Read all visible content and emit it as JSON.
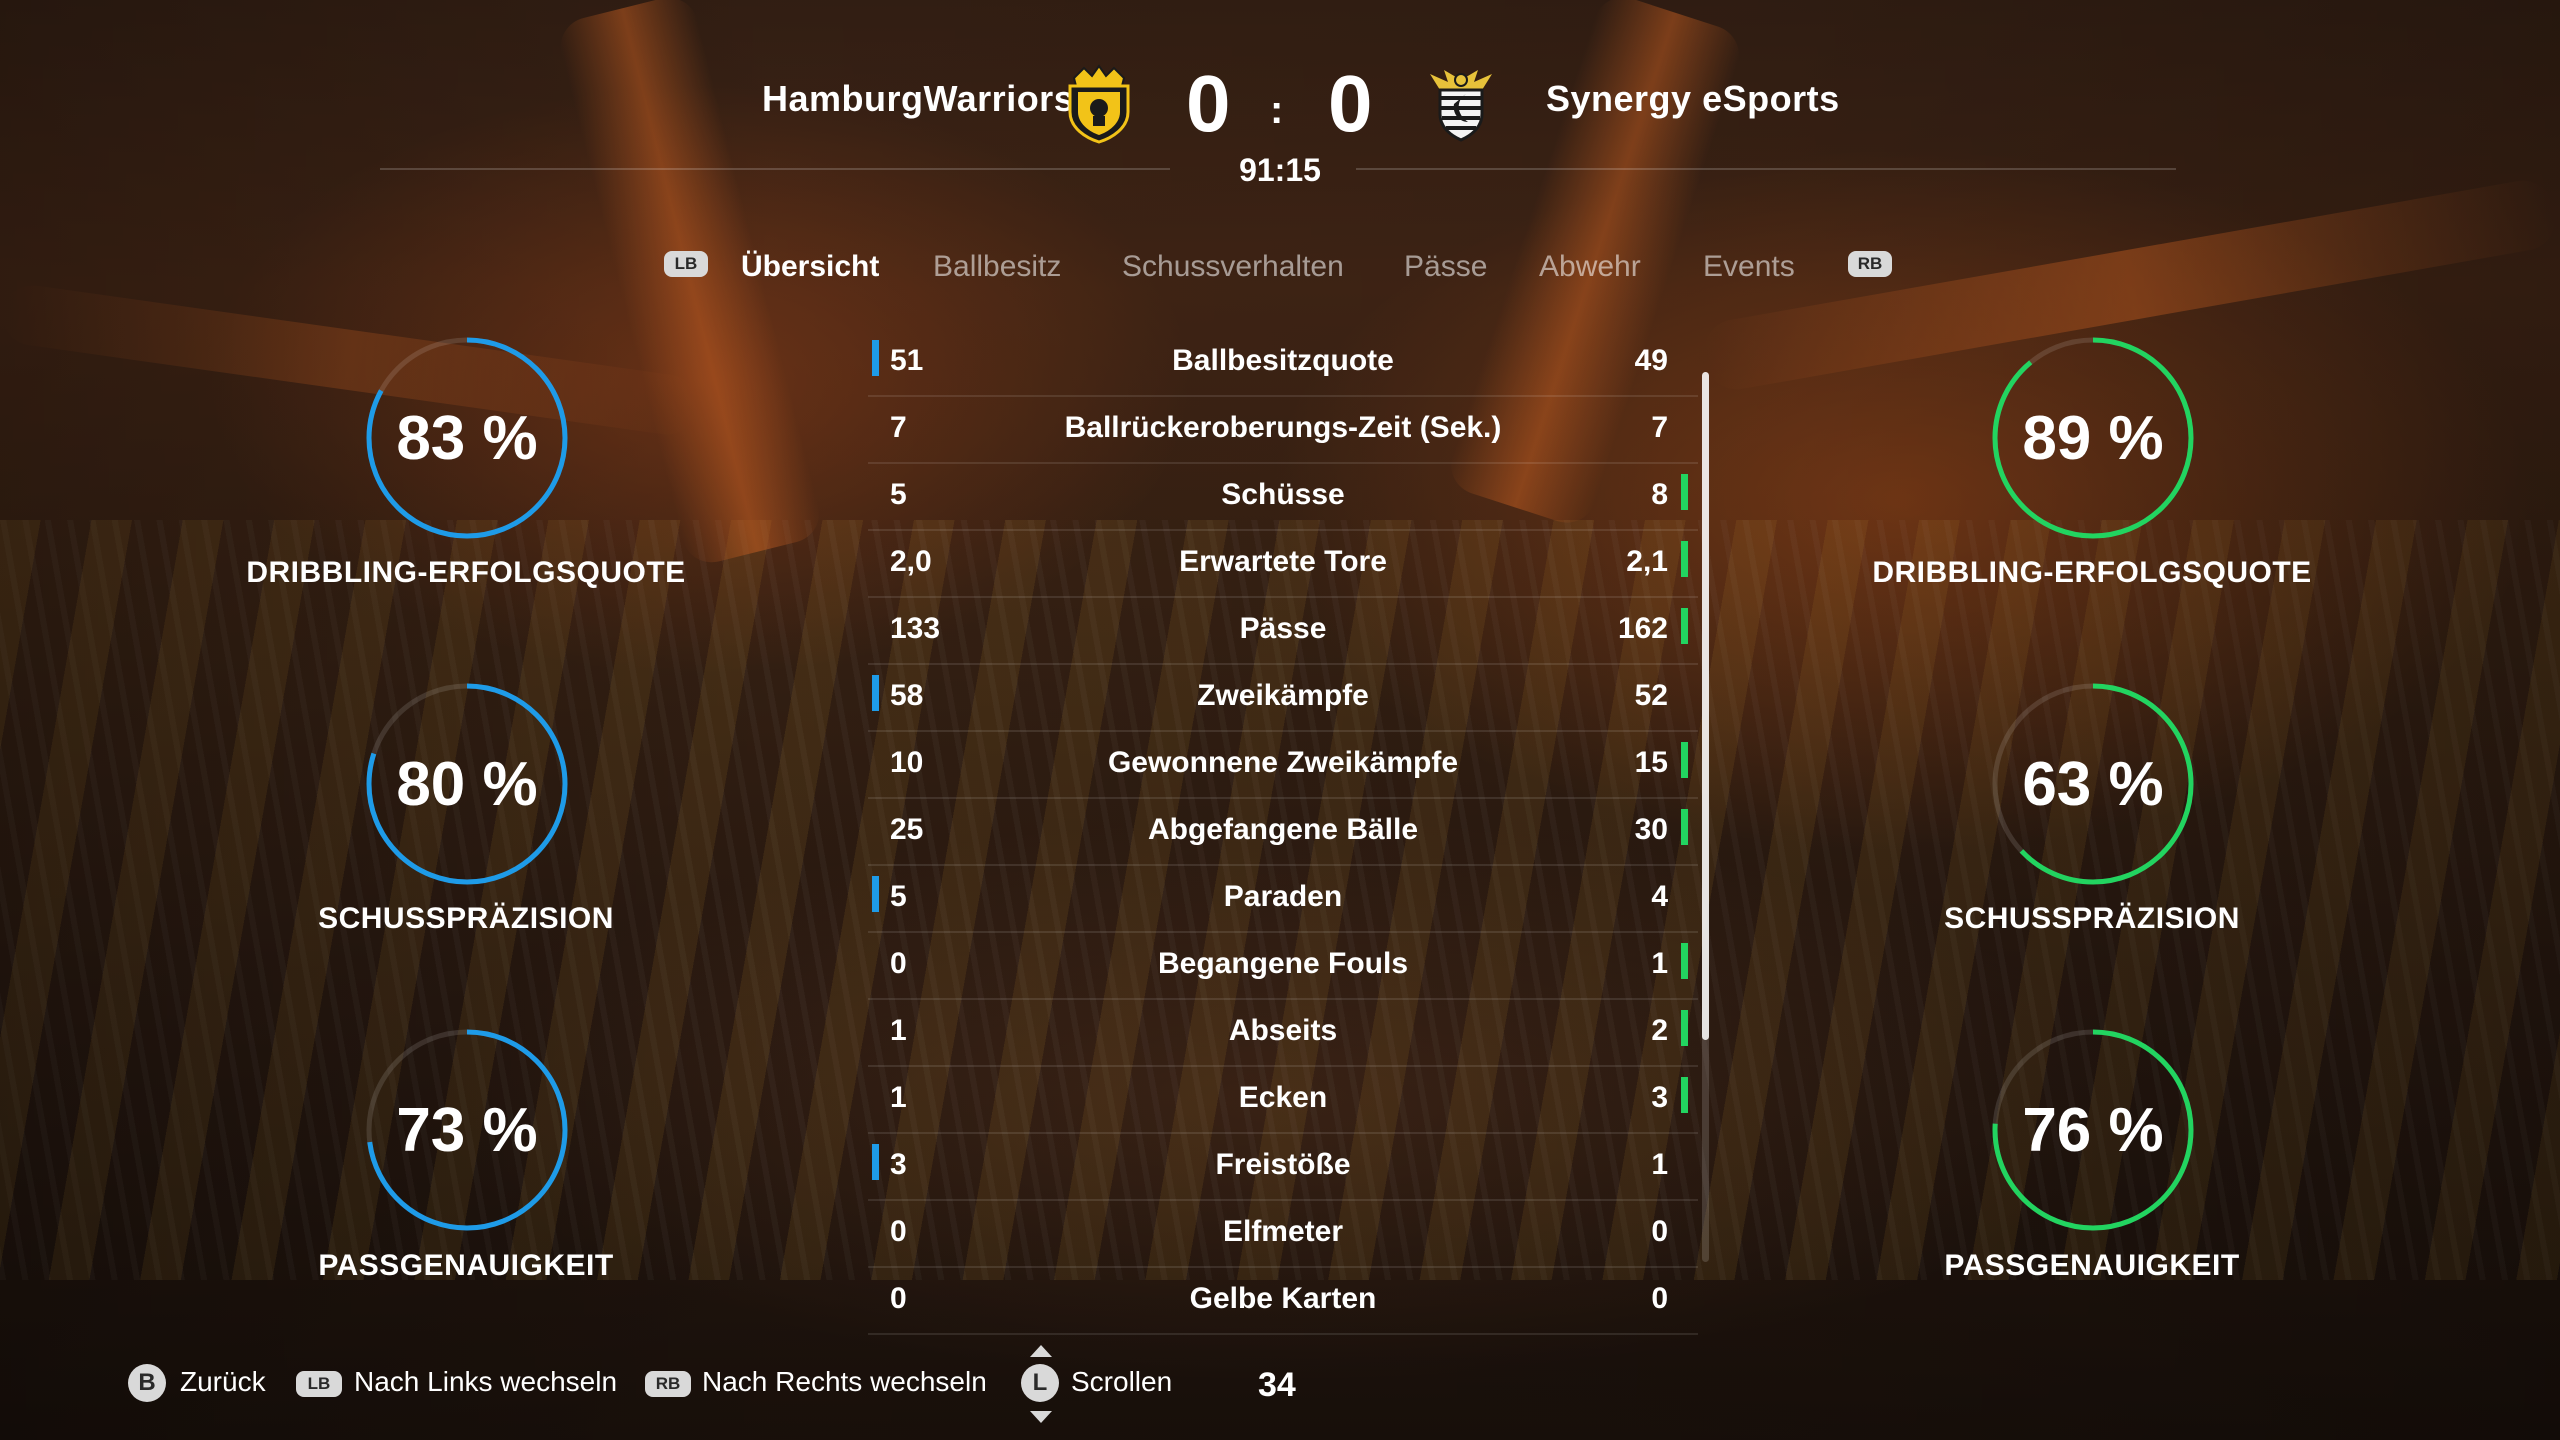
{
  "match": {
    "home_team": "HamburgWarriors",
    "away_team": "Synergy eSports",
    "home_score": "0",
    "away_score": "0",
    "separator": ":",
    "clock": "91:15"
  },
  "tabs": {
    "left_bumper": "LB",
    "right_bumper": "RB",
    "items": [
      {
        "label": "Übersicht",
        "active": true
      },
      {
        "label": "Ballbesitz",
        "active": false
      },
      {
        "label": "Schussverhalten",
        "active": false
      },
      {
        "label": "Pässe",
        "active": false
      },
      {
        "label": "Abwehr",
        "active": false
      },
      {
        "label": "Events",
        "active": false
      }
    ]
  },
  "home_rings": [
    {
      "value": "83 %",
      "percent": 83,
      "label": "DRIBBLING-ERFOLGSQUOTE"
    },
    {
      "value": "80 %",
      "percent": 80,
      "label": "SCHUSSPRÄZISION"
    },
    {
      "value": "73 %",
      "percent": 73,
      "label": "PASSGENAUIGKEIT"
    }
  ],
  "away_rings": [
    {
      "value": "89 %",
      "percent": 89,
      "label": "DRIBBLING-ERFOLGSQUOTE"
    },
    {
      "value": "63 %",
      "percent": 63,
      "label": "SCHUSSPRÄZISION"
    },
    {
      "value": "76 %",
      "percent": 76,
      "label": "PASSGENAUIGKEIT"
    }
  ],
  "colors": {
    "home_accent": "#1e9be8",
    "away_accent": "#22d460",
    "ring_track": "rgba(255,255,255,0.12)"
  },
  "stats": [
    {
      "home": "51",
      "label": "Ballbesitzquote",
      "away": "49",
      "leader": "home"
    },
    {
      "home": "7",
      "label": "Ballrückeroberungs-Zeit (Sek.)",
      "away": "7",
      "leader": "none"
    },
    {
      "home": "5",
      "label": "Schüsse",
      "away": "8",
      "leader": "away"
    },
    {
      "home": "2,0",
      "label": "Erwartete Tore",
      "away": "2,1",
      "leader": "away"
    },
    {
      "home": "133",
      "label": "Pässe",
      "away": "162",
      "leader": "away"
    },
    {
      "home": "58",
      "label": "Zweikämpfe",
      "away": "52",
      "leader": "home"
    },
    {
      "home": "10",
      "label": "Gewonnene Zweikämpfe",
      "away": "15",
      "leader": "away"
    },
    {
      "home": "25",
      "label": "Abgefangene Bälle",
      "away": "30",
      "leader": "away"
    },
    {
      "home": "5",
      "label": "Paraden",
      "away": "4",
      "leader": "home"
    },
    {
      "home": "0",
      "label": "Begangene Fouls",
      "away": "1",
      "leader": "away"
    },
    {
      "home": "1",
      "label": "Abseits",
      "away": "2",
      "leader": "away"
    },
    {
      "home": "1",
      "label": "Ecken",
      "away": "3",
      "leader": "away"
    },
    {
      "home": "3",
      "label": "Freistöße",
      "away": "1",
      "leader": "home"
    },
    {
      "home": "0",
      "label": "Elfmeter",
      "away": "0",
      "leader": "none"
    },
    {
      "home": "0",
      "label": "Gelbe Karten",
      "away": "0",
      "leader": "none"
    }
  ],
  "footer": {
    "back_button": "B",
    "back_label": "Zurück",
    "prev_button": "LB",
    "prev_label": "Nach Links wechseln",
    "next_button": "RB",
    "next_label": "Nach Rechts wechseln",
    "scroll_button": "L",
    "scroll_label": "Scrollen",
    "page_number": "34"
  }
}
